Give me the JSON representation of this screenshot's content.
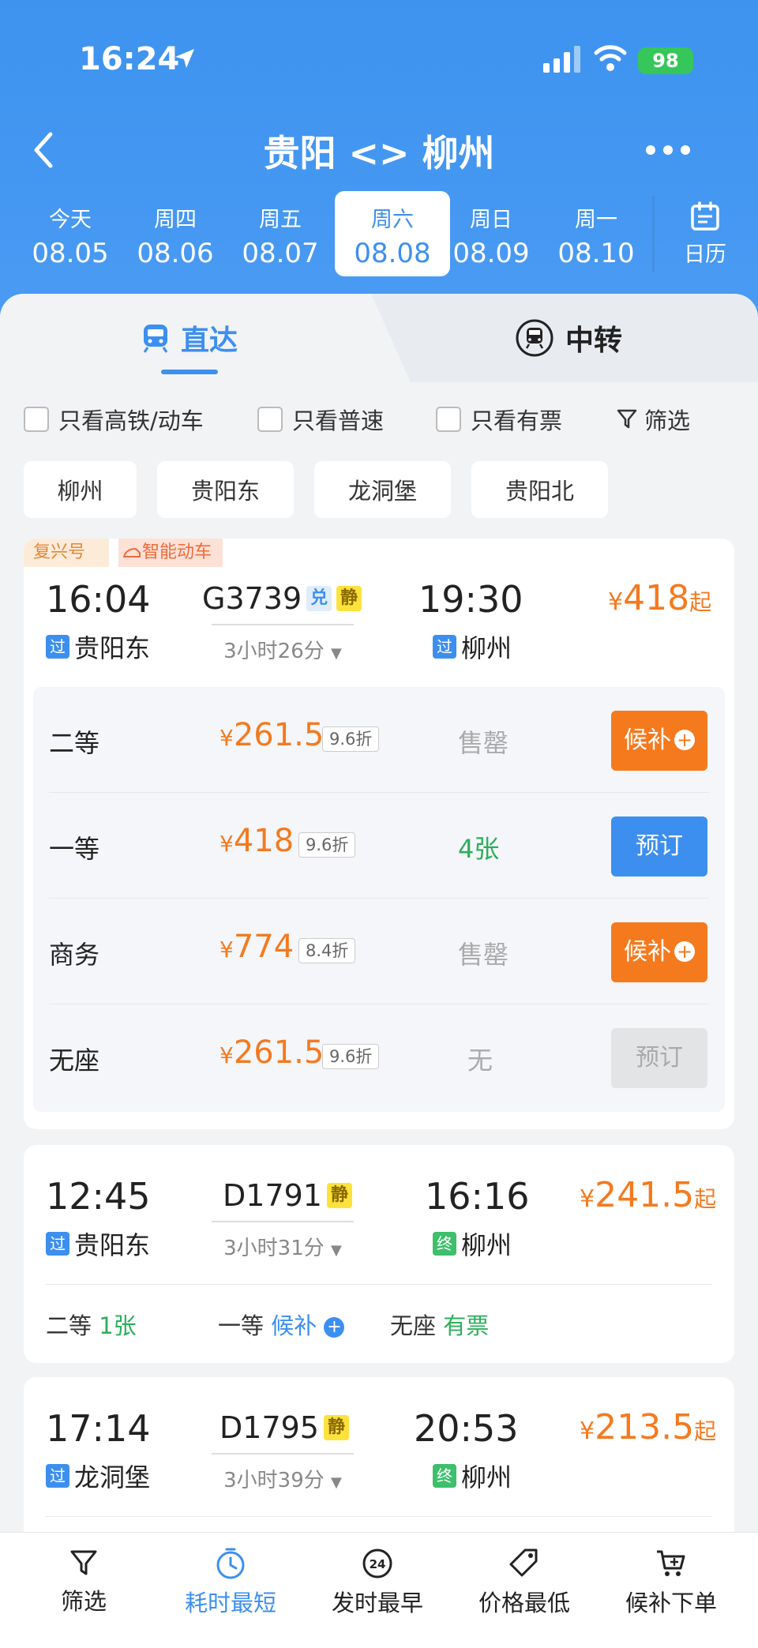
{
  "status": {
    "time": "16:24",
    "battery": "98"
  },
  "nav": {
    "title": "贵阳 <> 柳州"
  },
  "dates": [
    {
      "weekday": "今天",
      "date": "08.05"
    },
    {
      "weekday": "周四",
      "date": "08.06"
    },
    {
      "weekday": "周五",
      "date": "08.07"
    },
    {
      "weekday": "周六",
      "date": "08.08",
      "selected": true
    },
    {
      "weekday": "周日",
      "date": "08.09"
    },
    {
      "weekday": "周一",
      "date": "08.10"
    }
  ],
  "calendar_label": "日历",
  "tabs": {
    "direct": "直达",
    "transfer": "中转"
  },
  "filters": {
    "hsr_only": "只看高铁/动车",
    "regular_only": "只看普速",
    "available_only": "只看有票",
    "filter": "筛选"
  },
  "stations": [
    "柳州",
    "贵阳东",
    "龙洞堡",
    "贵阳北"
  ],
  "trains": [
    {
      "tags": [
        "复兴号",
        "智能动车"
      ],
      "depart_time": "16:04",
      "train_no": "G3739",
      "badges": [
        "兑",
        "静"
      ],
      "arrive_time": "19:30",
      "duration": "3小时26分",
      "from_tag": "过",
      "from": "贵阳东",
      "to_tag": "过",
      "to": "柳州",
      "price": "418",
      "price_suffix": "起",
      "seats": [
        {
          "name": "二等",
          "price": "261.5",
          "discount": "9.6折",
          "status": "售罄",
          "action": "候补"
        },
        {
          "name": "一等",
          "price": "418",
          "discount": "9.6折",
          "status": "4张",
          "action": "预订"
        },
        {
          "name": "商务",
          "price": "774",
          "discount": "8.4折",
          "status": "售罄",
          "action": "候补"
        },
        {
          "name": "无座",
          "price": "261.5",
          "discount": "9.6折",
          "status": "无",
          "action": "预订"
        }
      ]
    },
    {
      "depart_time": "12:45",
      "train_no": "D1791",
      "badges": [
        "静"
      ],
      "arrive_time": "16:16",
      "duration": "3小时31分",
      "from_tag": "过",
      "from": "贵阳东",
      "to_tag": "终",
      "to": "柳州",
      "price": "241.5",
      "price_suffix": "起",
      "summary": [
        {
          "name": "二等",
          "status": "1张"
        },
        {
          "name": "一等",
          "status": "候补"
        },
        {
          "name": "无座",
          "status": "有票"
        }
      ]
    },
    {
      "depart_time": "17:14",
      "train_no": "D1795",
      "badges": [
        "静"
      ],
      "arrive_time": "20:53",
      "duration": "3小时39分",
      "from_tag": "过",
      "from": "龙洞堡",
      "to_tag": "终",
      "to": "柳州",
      "price": "213.5",
      "price_suffix": "起"
    }
  ],
  "bottom_bar": [
    {
      "label": "筛选",
      "icon": "funnel-icon"
    },
    {
      "label": "耗时最短",
      "icon": "timer-icon",
      "active": true
    },
    {
      "label": "发时最早",
      "icon": "clock-24-icon"
    },
    {
      "label": "价格最低",
      "icon": "price-tag-icon"
    },
    {
      "label": "候补下单",
      "icon": "cart-icon"
    }
  ],
  "colors": {
    "primary": "#3d8fef",
    "orange": "#f47a1f",
    "green": "#2dae5a"
  }
}
